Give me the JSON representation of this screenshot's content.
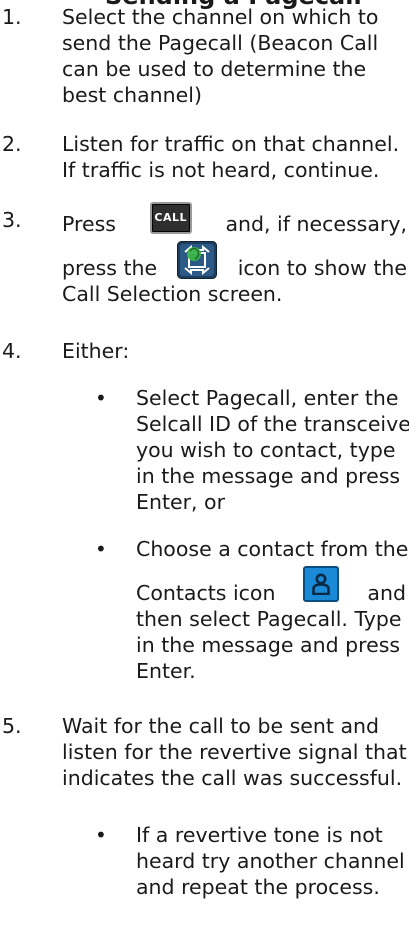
{
  "title_fragment": "Sending a Pagecall",
  "steps": [
    {
      "num": "1.",
      "lines": [
        "Select the channel on which to",
        "send the Pagecall (Beacon Call",
        "can be used to determine the",
        "best channel)"
      ]
    },
    {
      "num": "2.",
      "lines": [
        "Listen for traffic on that channel.",
        "If traffic is not heard, continue."
      ]
    },
    {
      "num": "3.",
      "press": "Press",
      "call_label": "CALL",
      "and_if": "and, if necessary,",
      "press_the": "press the",
      "icon_to_show": "icon to show the",
      "last": "Call Selection screen."
    },
    {
      "num": "4.",
      "lines": [
        "Either:"
      ]
    },
    {
      "num": "5.",
      "lines": [
        "Wait for the call to be sent and",
        "listen for the revertive signal that",
        "indicates the call was successful."
      ]
    }
  ],
  "bullets_4": [
    {
      "bullet": "•",
      "lines": [
        "Select Pagecall, enter the",
        "Selcall ID of the transceiver",
        "you wish to contact, type",
        "in the message and press",
        "Enter, or"
      ]
    },
    {
      "bullet": "•",
      "line1": "Choose a contact from the",
      "contacts": "Contacts icon",
      "and": "and",
      "lines": [
        "then select Pagecall. Type",
        "in the message and press",
        "Enter."
      ]
    }
  ],
  "bullets_5": [
    {
      "bullet": "•",
      "lines": [
        "If a revertive tone is not",
        "heard try another channel",
        "and repeat the process."
      ]
    }
  ],
  "icons": {
    "call_button": "call-button-icon",
    "call_select": "call-selection-icon",
    "contacts": "contacts-icon"
  },
  "colors": {
    "text": "#1a1a1a",
    "contacts_icon": "#1a8ad6",
    "call_select_icon": "#3ab34a"
  }
}
